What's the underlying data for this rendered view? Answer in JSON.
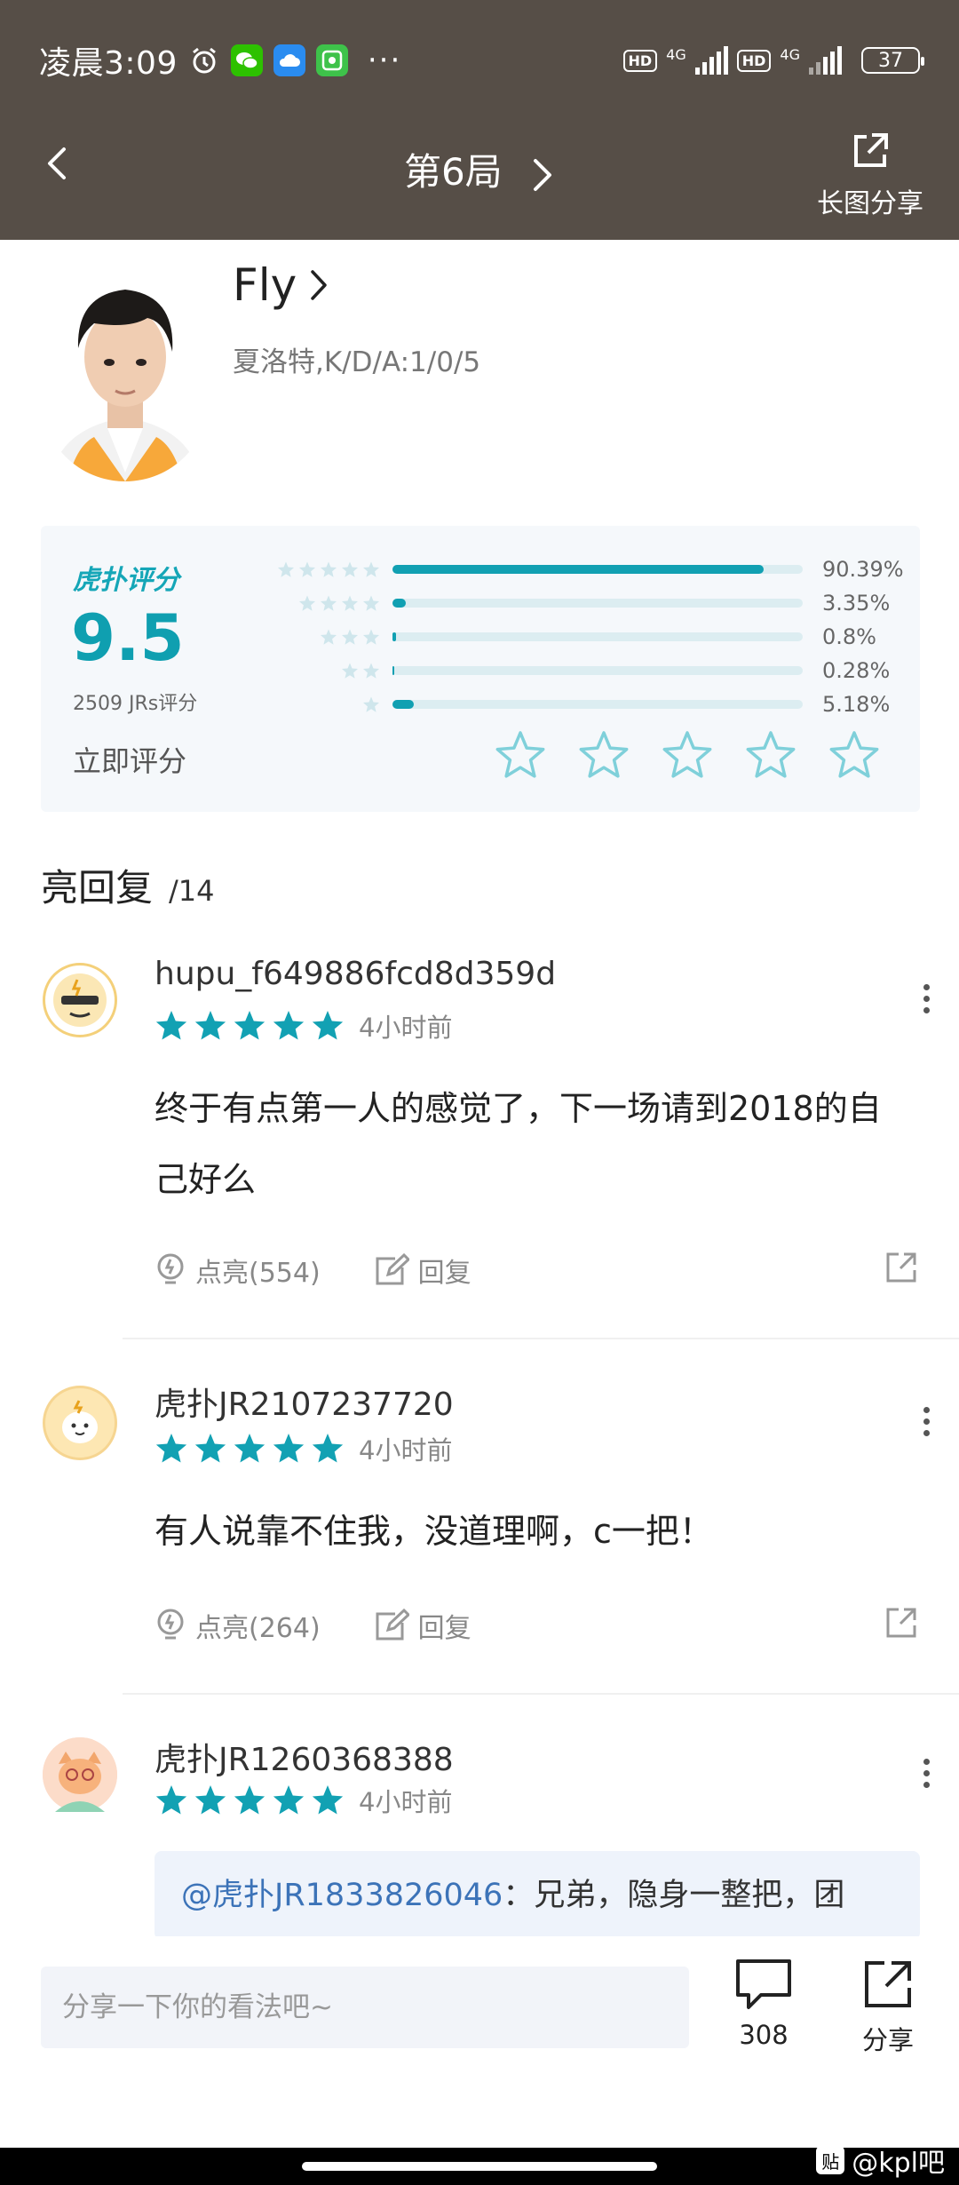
{
  "status_bar": {
    "time": "凌晨3:09",
    "dots": "···",
    "hd1": "HD",
    "net1": "4G",
    "hd2": "HD",
    "net2": "4G",
    "battery": "37"
  },
  "nav": {
    "title": "第6局",
    "share_long_label": "长图分享"
  },
  "player": {
    "name": "Fly",
    "stats": "夏洛特,K/D/A:1/0/5"
  },
  "rating": {
    "logo": "虎扑评分",
    "score": "9.5",
    "count": "2509 JRs评分",
    "rate_now": "立即评分",
    "bars": [
      {
        "stars": 5,
        "fraction": 0.9039,
        "pct": "90.39%"
      },
      {
        "stars": 4,
        "fraction": 0.0335,
        "pct": "3.35%"
      },
      {
        "stars": 3,
        "fraction": 0.008,
        "pct": "0.8%"
      },
      {
        "stars": 2,
        "fraction": 0.0028,
        "pct": "0.28%"
      },
      {
        "stars": 1,
        "fraction": 0.0518,
        "pct": "5.18%"
      }
    ],
    "accent": "#11a0b2"
  },
  "section": {
    "title": "亮回复",
    "count": "/14"
  },
  "comments": [
    {
      "user": "hupu_f649886fcd8d359d",
      "time": "4小时前",
      "stars": 5,
      "text": "终于有点第一人的感觉了，下一场请到2018的自己好么",
      "like": "点亮(554)",
      "reply": "回复"
    },
    {
      "user": "虎扑JR2107237720",
      "time": "4小时前",
      "stars": 5,
      "text": "有人说靠不住我，没道理啊，c一把！",
      "like": "点亮(264)",
      "reply": "回复"
    },
    {
      "user": "虎扑JR1260368388",
      "time": "4小时前",
      "stars": 5,
      "quote_at": "@虎扑JR1833826046",
      "quote_text": "：兄弟，隐身一整把，团"
    }
  ],
  "bottom": {
    "input_placeholder": "分享一下你的看法吧~",
    "comment_count": "308",
    "share_label": "分享"
  },
  "watermark": {
    "icon": "贴",
    "text": "@kpl吧"
  },
  "colors": {
    "header_bg": "#564e47",
    "star_blue": "#12a1b3",
    "link_blue": "#3c73b8"
  }
}
